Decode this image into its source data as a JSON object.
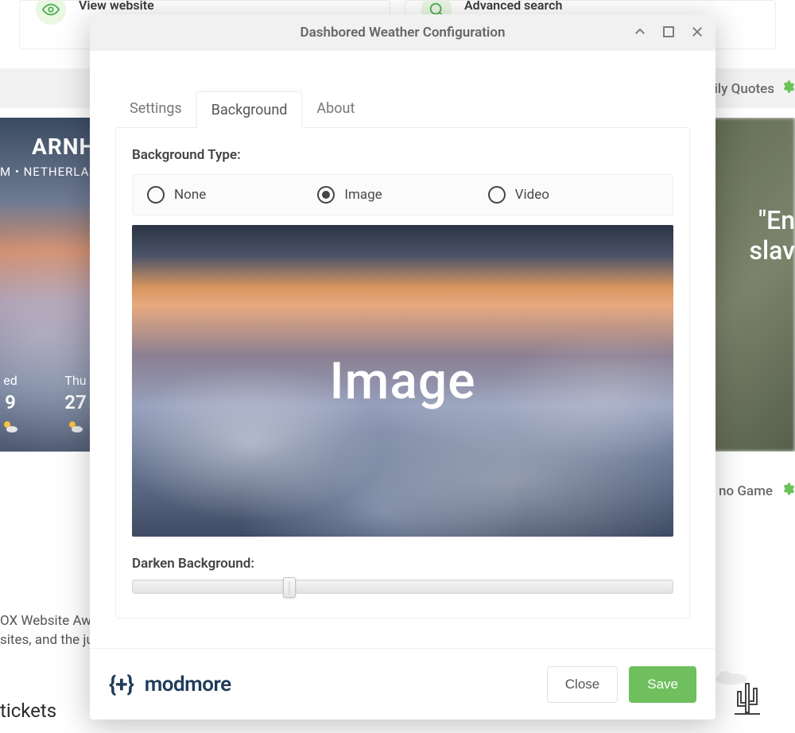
{
  "background": {
    "cards": {
      "view_website": "View website",
      "advanced_search": "Advanced search"
    },
    "top_strip_label": "ily Quotes",
    "weather": {
      "city": "ARNHE",
      "subline": "M  •  NETHERLA",
      "left_day": "ed",
      "left_temp": "9",
      "right_day": "Thu",
      "right_temp": "27"
    },
    "quotes_panel": {
      "line1": "\"En",
      "line2": "slav"
    },
    "game_label": "no Game",
    "award_line1": "OX Website Awar",
    "award_line2": "sites, and the jud",
    "tickets": "tickets"
  },
  "modal": {
    "title": "Dashbored Weather Configuration",
    "tabs": {
      "settings": "Settings",
      "background": "Background",
      "about": "About"
    },
    "bg_type_label": "Background Type:",
    "options": {
      "none": "None",
      "image": "Image",
      "video": "Video",
      "selected": "image"
    },
    "preview_text": "Image",
    "darken_label": "Darken Background:",
    "darken_value_pct": 29,
    "footer": {
      "brand_icon": "{+}",
      "brand_text": "modmore",
      "close": "Close",
      "save": "Save"
    }
  }
}
